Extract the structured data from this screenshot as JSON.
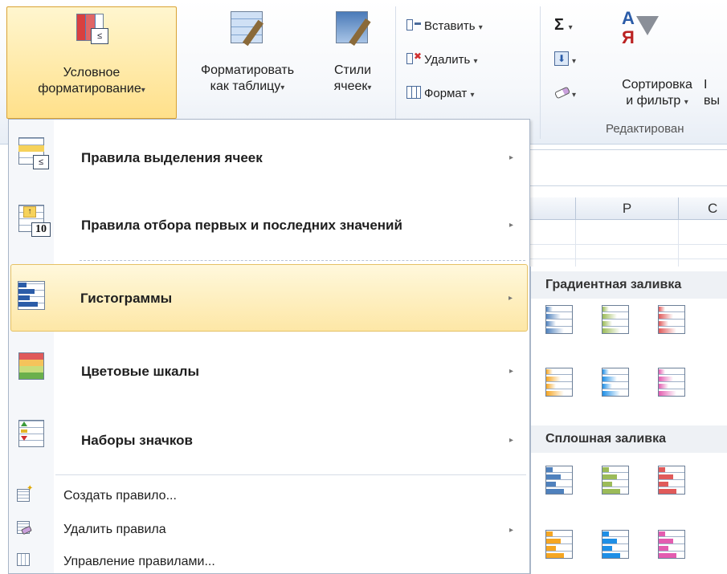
{
  "ribbon": {
    "cf_button": {
      "line1": "Условное",
      "line2": "форматирование",
      "arrow": "▾"
    },
    "table_button": {
      "line1": "Форматировать",
      "line2": "как таблицу",
      "arrow": "▾"
    },
    "styles_button": {
      "line1": "Стили",
      "line2": "ячеек",
      "arrow": "▾"
    },
    "insert": {
      "label": "Вставить",
      "arrow": "▾"
    },
    "delete": {
      "label": "Удалить",
      "arrow": "▾"
    },
    "format": {
      "label": "Формат",
      "arrow": "▾"
    },
    "sigma": {
      "label": "Σ",
      "arrow": "▾"
    },
    "fill_arrow": "▾",
    "clear_arrow": "▾",
    "sort": {
      "icon_top": "А",
      "icon_bottom": "Я",
      "line1": "Сортировка",
      "line2": "и фильтр",
      "arrow": "▾"
    },
    "cut_right": {
      "line1": "I",
      "line2": "вы"
    },
    "group_label": "Редактирован"
  },
  "sheet": {
    "columns": [
      "P",
      "C"
    ]
  },
  "menu": {
    "items": [
      {
        "label": "Правила выделения ячеек",
        "icon": "highlight-cells-rules-icon"
      },
      {
        "label": "Правила отбора первых и последних значений",
        "icon": "top-bottom-rules-icon",
        "icon_text": "10"
      },
      {
        "label": "Гистограммы",
        "icon": "data-bars-icon"
      },
      {
        "label": "Цветовые шкалы",
        "icon": "color-scales-icon"
      },
      {
        "label": "Наборы значков",
        "icon": "icon-sets-icon"
      }
    ],
    "small_items": [
      {
        "label": "Создать правило...",
        "icon": "new-rule-icon"
      },
      {
        "label": "Удалить правила",
        "icon": "clear-rules-icon"
      },
      {
        "label": "Управление правилами...",
        "icon": "manage-rules-icon"
      }
    ],
    "submenu_arrow": "▸"
  },
  "submenu": {
    "gradient_header": "Градиентная заливка",
    "solid_header": "Сплошная заливка",
    "colors": [
      "#4f81bd",
      "#9bbb59",
      "#e05a5a",
      "#f5a623",
      "#1f8fe6",
      "#e35db0"
    ]
  }
}
